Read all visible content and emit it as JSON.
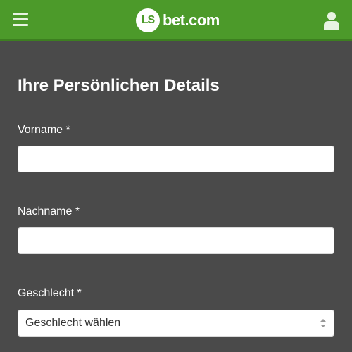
{
  "header": {
    "menu_icon": "hamburger-menu-icon",
    "logo": {
      "badge": "LS",
      "text": "bet.com"
    },
    "user_icon": "user-icon",
    "bg_color": "#4c9a2a"
  },
  "form": {
    "title": "Ihre Persönlichen Details",
    "first_name": {
      "label": "Vorname *",
      "value": "",
      "placeholder": ""
    },
    "last_name": {
      "label": "Nachname *",
      "value": "",
      "placeholder": ""
    },
    "gender": {
      "label": "Geschlecht *",
      "selected": "Geschlecht wählen"
    }
  }
}
